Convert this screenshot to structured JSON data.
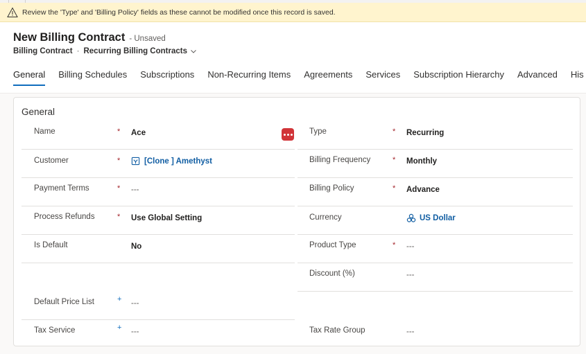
{
  "notice": {
    "message": "Review the 'Type' and 'Billing Policy' fields as these cannot be modified once this record is saved.",
    "icon": "warning-icon"
  },
  "header": {
    "title": "New Billing Contract",
    "status": "- Unsaved",
    "breadcrumb_entity": "Billing Contract",
    "breadcrumb_separator": "·",
    "breadcrumb_form": "Recurring Billing Contracts"
  },
  "tabs": [
    {
      "label": "General"
    },
    {
      "label": "Billing Schedules"
    },
    {
      "label": "Subscriptions"
    },
    {
      "label": "Non-Recurring Items"
    },
    {
      "label": "Agreements"
    },
    {
      "label": "Services"
    },
    {
      "label": "Subscription Hierarchy"
    },
    {
      "label": "Advanced"
    },
    {
      "label": "His"
    }
  ],
  "section": {
    "title": "General"
  },
  "fields": {
    "name": {
      "label": "Name",
      "value": "Ace",
      "required": "*"
    },
    "customer": {
      "label": "Customer",
      "value": "[Clone ] Amethyst",
      "required": "*"
    },
    "payment_terms": {
      "label": "Payment Terms",
      "value": "---",
      "required": "*"
    },
    "process_refunds": {
      "label": "Process Refunds",
      "value": "Use Global Setting",
      "required": "*"
    },
    "is_default": {
      "label": "Is Default",
      "value": "No"
    },
    "default_price_list": {
      "label": "Default Price List",
      "value": "---",
      "recommended": "+"
    },
    "tax_service": {
      "label": "Tax Service",
      "value": "---",
      "recommended": "+"
    },
    "type": {
      "label": "Type",
      "value": "Recurring",
      "required": "*"
    },
    "billing_frequency": {
      "label": "Billing Frequency",
      "value": "Monthly",
      "required": "*"
    },
    "billing_policy": {
      "label": "Billing Policy",
      "value": "Advance",
      "required": "*"
    },
    "currency": {
      "label": "Currency",
      "value": "US Dollar"
    },
    "product_type": {
      "label": "Product Type",
      "value": "---",
      "required": "*"
    },
    "discount": {
      "label": "Discount (%)",
      "value": "---"
    },
    "tax_rate_group": {
      "label": "Tax Rate Group",
      "value": "---"
    }
  },
  "colors": {
    "accent": "#0f6cbd",
    "required": "#a4262c",
    "notice_bg": "#fff4ce",
    "action_button": "#d13438"
  }
}
